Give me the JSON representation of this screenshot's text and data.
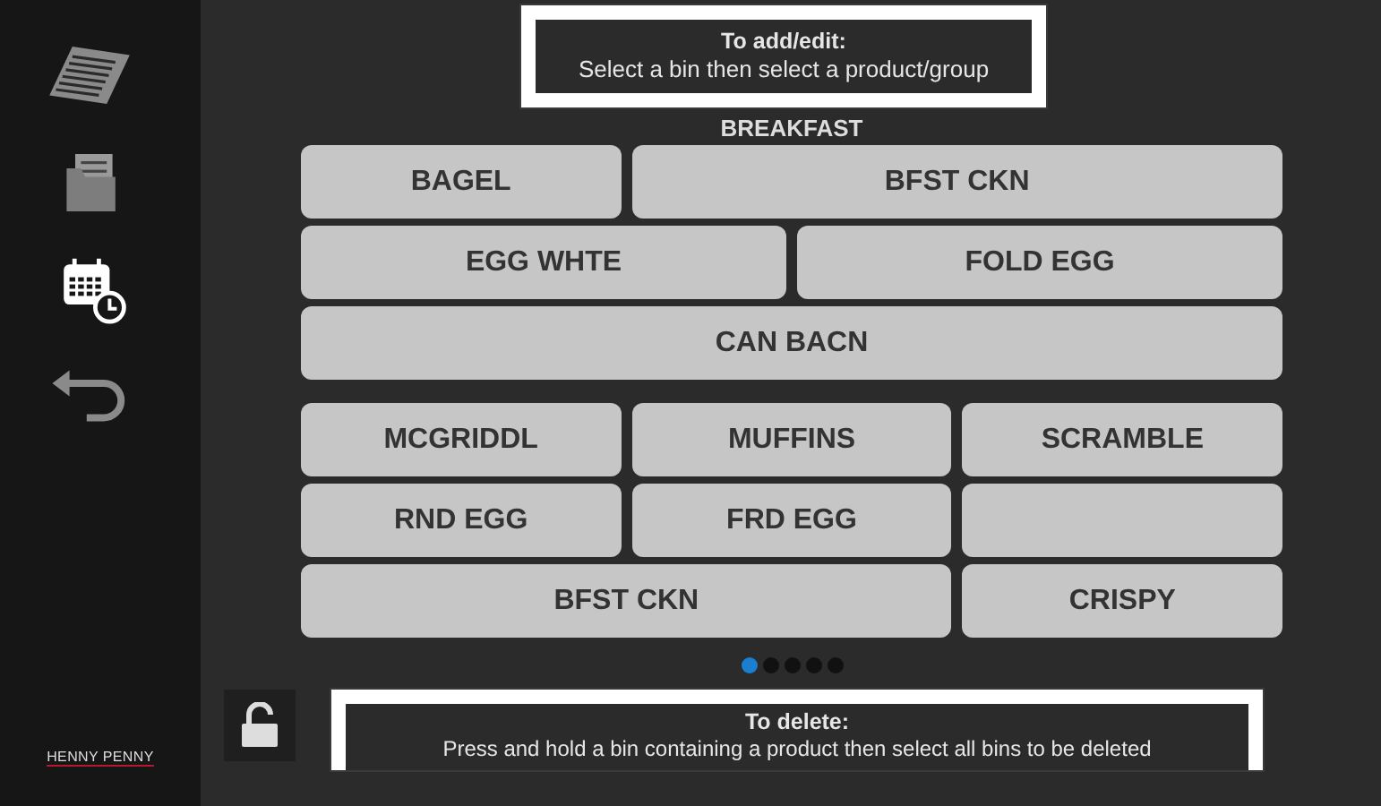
{
  "sidebar": {
    "items": [
      {
        "kind": "list"
      },
      {
        "kind": "folder"
      },
      {
        "kind": "calendar"
      },
      {
        "kind": "back"
      }
    ],
    "logo": "HENNY PENNY"
  },
  "hint_top": {
    "title": "To add/edit:",
    "text": "Select a bin then select a product/group"
  },
  "group_title": "BREAKFAST",
  "sections": [
    {
      "bins": [
        {
          "label": "BAGEL",
          "kind": "narrow"
        },
        {
          "label": "BFST CKN",
          "kind": "wide"
        },
        {
          "label": "EGG WHTE",
          "kind": "half"
        },
        {
          "label": "FOLD EGG",
          "kind": "half"
        },
        {
          "label": "CAN BACN",
          "kind": "full"
        }
      ]
    },
    {
      "bins": [
        {
          "label": "MCGRIDDL",
          "kind": "narrow"
        },
        {
          "label": "MUFFINS",
          "kind": "narrow"
        },
        {
          "label": "SCRAMBLE",
          "kind": "narrow"
        },
        {
          "label": "RND EGG",
          "kind": "narrow"
        },
        {
          "label": "FRD EGG",
          "kind": "narrow"
        },
        {
          "kind": "narrow"
        },
        {
          "label": "BFST CKN",
          "kind": "wide"
        },
        {
          "label": "CRISPY",
          "kind": "narrow"
        }
      ]
    }
  ],
  "pages": [
    {
      "selected": true
    },
    {
      "selected": false
    },
    {
      "selected": false
    },
    {
      "selected": false
    },
    {
      "selected": false
    }
  ],
  "locked": false,
  "hint_bottom": {
    "title": "To delete:",
    "text": "Press and hold a bin containing a product then select all bins to be deleted"
  }
}
